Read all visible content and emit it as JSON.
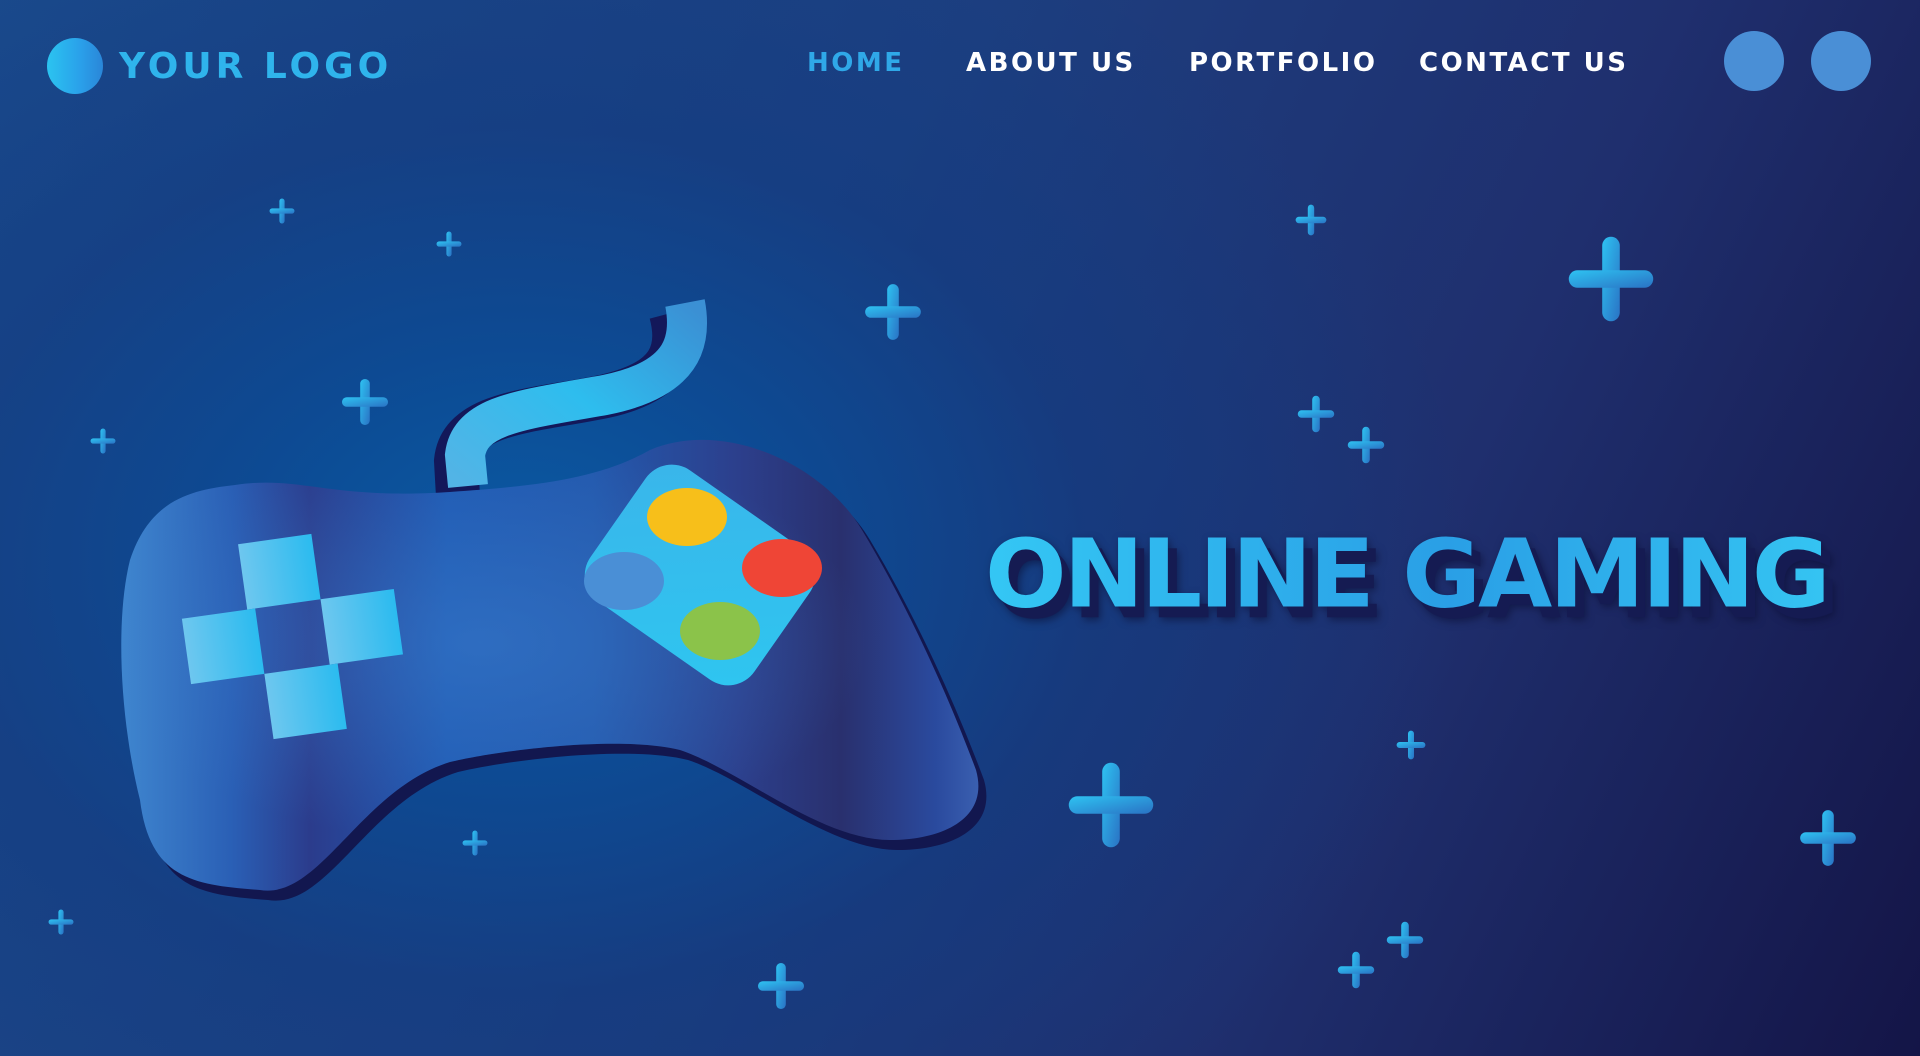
{
  "header": {
    "logo_text": "YOUR LOGO",
    "nav": [
      {
        "label": "HOME",
        "active": true
      },
      {
        "label": "ABOUT US",
        "active": false
      },
      {
        "label": "PORTFOLIO",
        "active": false
      },
      {
        "label": "CONTACT US",
        "active": false
      }
    ],
    "circle_buttons": 2
  },
  "hero": {
    "title": "ONLINE GAMING",
    "illustration": "gamepad-icon"
  },
  "colors": {
    "accent": "#2fb4ec",
    "background_start": "#1a4a8c",
    "background_end": "#141547",
    "button_yellow": "#f7bf1a",
    "button_red": "#ef4536",
    "button_green": "#8bc34a",
    "button_blue": "#4a8fd6"
  }
}
